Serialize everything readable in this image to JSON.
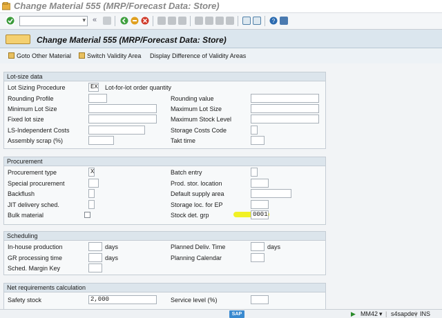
{
  "window": {
    "title": "Change Material 555 (MRP/Forecast Data: Store)"
  },
  "toolbar": {
    "command_value": "",
    "icons": [
      "enter-icon",
      "save-icon",
      "back-icon",
      "exit-icon",
      "cancel-icon",
      "print-icon",
      "find-icon",
      "find-next-icon",
      "first-page-icon",
      "prev-page-icon",
      "next-page-icon",
      "last-page-icon",
      "new-session-icon",
      "shortcut-icon",
      "help-icon",
      "customize-icon"
    ]
  },
  "header": {
    "title": "Change Material 555 (MRP/Forecast Data: Store)"
  },
  "app_toolbar": {
    "goto_other": "Goto Other Material",
    "switch_validity": "Switch Validity Area",
    "display_diff": "Display Difference of Validity Areas"
  },
  "lot_size": {
    "title": "Lot-size data",
    "lot_sizing_procedure": {
      "label": "Lot Sizing Procedure",
      "value": "EX",
      "desc": "Lot-for-lot order quantity"
    },
    "rounding_profile": {
      "label": "Rounding Profile",
      "value": ""
    },
    "rounding_value": {
      "label": "Rounding value",
      "value": ""
    },
    "min_lot_size": {
      "label": "Minimum Lot Size",
      "value": ""
    },
    "max_lot_size": {
      "label": "Maximum Lot Size",
      "value": ""
    },
    "fixed_lot_size": {
      "label": "Fixed lot size",
      "value": ""
    },
    "max_stock_level": {
      "label": "Maximum Stock Level",
      "value": ""
    },
    "ls_indep_costs": {
      "label": "LS-Independent Costs",
      "value": ""
    },
    "storage_costs_code": {
      "label": "Storage Costs Code",
      "value": ""
    },
    "assembly_scrap": {
      "label": "Assembly scrap (%)",
      "value": ""
    },
    "takt_time": {
      "label": "Takt time",
      "value": ""
    }
  },
  "procurement": {
    "title": "Procurement",
    "procurement_type": {
      "label": "Procurement type",
      "value": "X"
    },
    "batch_entry": {
      "label": "Batch entry",
      "value": ""
    },
    "special_procurement": {
      "label": "Special procurement",
      "value": ""
    },
    "prod_stor_location": {
      "label": "Prod. stor. location",
      "value": ""
    },
    "backflush": {
      "label": "Backflush",
      "value": ""
    },
    "default_supply_area": {
      "label": "Default supply area",
      "value": ""
    },
    "jit_delivery": {
      "label": "JIT delivery sched.",
      "value": ""
    },
    "storage_loc_ep": {
      "label": "Storage loc. for EP",
      "value": ""
    },
    "bulk_material": {
      "label": "Bulk material",
      "checked": false
    },
    "stock_det_grp": {
      "label": "Stock det. grp",
      "value": "0001"
    }
  },
  "scheduling": {
    "title": "Scheduling",
    "inhouse_production": {
      "label": "In-house production",
      "value": "",
      "unit": "days"
    },
    "planned_deliv_time": {
      "label": "Planned Deliv. Time",
      "value": "",
      "unit": "days"
    },
    "gr_processing_time": {
      "label": "GR processing time",
      "value": "",
      "unit": "days"
    },
    "planning_calendar": {
      "label": "Planning Calendar",
      "value": ""
    },
    "sched_margin_key": {
      "label": "Sched. Margin Key",
      "value": ""
    }
  },
  "net_req": {
    "title": "Net requirements calculation",
    "safety_stock": {
      "label": "Safety stock",
      "value": "2,000"
    },
    "service_level": {
      "label": "Service level (%)",
      "value": ""
    }
  },
  "status_bar": {
    "logo": "SAP",
    "transaction": "MM42",
    "server": "s4sapdev",
    "mode": "INS"
  },
  "colors": {
    "highlight": "#f0f000",
    "header_bg": "#dbe6ee"
  }
}
